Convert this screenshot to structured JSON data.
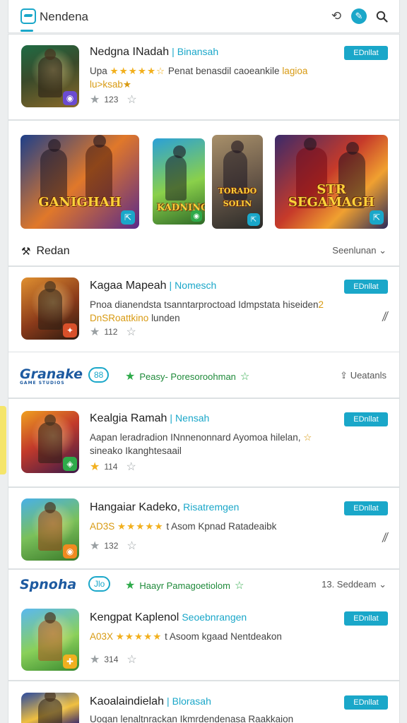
{
  "header": {
    "title": "Nendena"
  },
  "featured": {
    "title": "Nedgna INadah",
    "developer": "Binansah",
    "desc_prefix": "Upa",
    "stars": "★★★★★",
    "half_star": "☆",
    "desc_text": "Penat benasdil caoeankile",
    "desc_highlight": "lagioa",
    "desc_line2": "lu>ksab★",
    "rating": "123",
    "button": "EDnllat"
  },
  "banners": [
    {
      "text": "GANIGHAH"
    },
    {
      "text": "KADNING"
    },
    {
      "text": "TORADO SOLIN"
    },
    {
      "text": "STR SEGAMAGH"
    }
  ],
  "section": {
    "title": "Redan",
    "link": "Seenlunan"
  },
  "apps": [
    {
      "title": "Kagaa Mapeah",
      "developer": "Nomesch",
      "desc": "Pnoa dianendsta tsanntarproctoad Idmpstata hiseiden",
      "desc_highlight": "2",
      "desc_line2_highlight": "DnSRoattkino",
      "desc_line2": "lunden",
      "rating": "112",
      "button": "EDnllat"
    },
    {
      "title": "Kealgia Ramah",
      "developer": "Nensah",
      "desc": "Aapan leradradion INnnenonnard Ayomoa hilelan,",
      "desc_highlight": "☆",
      "desc_line2": "sineako Ikanghtesaail",
      "rating": "114",
      "button": "EDnllat"
    },
    {
      "title": "Hangaiar Kadeko,",
      "developer": "Risatremgen",
      "desc_prefix": "AD3S",
      "stars": "★★★★★",
      "desc": "t Asom Kpnad Ratadeaibk",
      "rating": "132",
      "button": "EDnllat"
    },
    {
      "title": "Kengpat Kaplenol",
      "developer": "Seoebnrangen",
      "desc_prefix": "A03X",
      "stars": "★★★★★",
      "desc": "t Asoom kgaad Nentdeakon",
      "rating": "314",
      "button": "EDnllat"
    },
    {
      "title": "Kaoalaindielah",
      "developer": "Blorasah",
      "desc": "Uogan lenaltnrackan Ikmrdendenasa Raakkaion",
      "button": "EDnllat"
    }
  ],
  "promos": [
    {
      "logo": "Granake",
      "logo_sub": "GAME STUDIOS",
      "pill": "88",
      "text": "Peasy- Poresoroohman",
      "right": "Ueatanls"
    },
    {
      "logo": "Spnoha",
      "pill": "Jlo",
      "text": "Haayr Pamagoetiolom",
      "right": "13. Seddeam"
    }
  ]
}
